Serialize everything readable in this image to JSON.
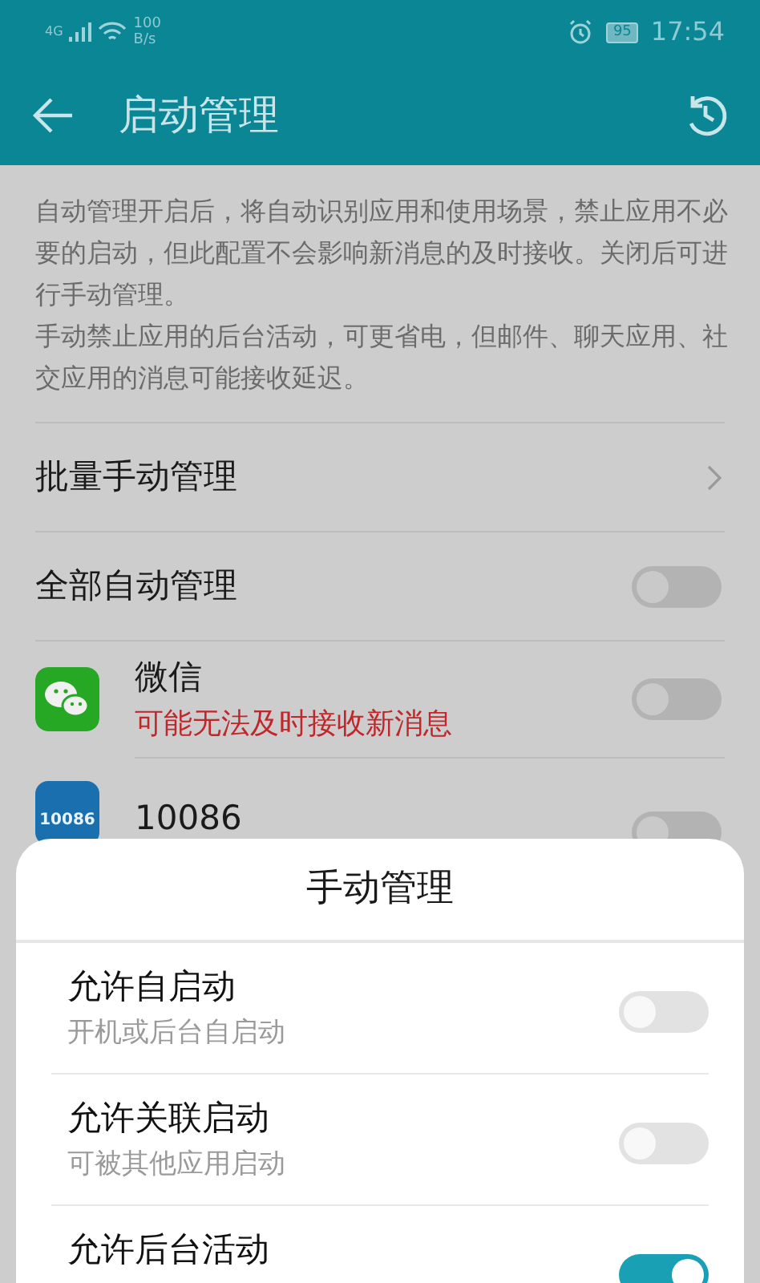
{
  "status_bar": {
    "network": "4G",
    "speed_value": "100",
    "speed_unit": "B/s",
    "battery": "95",
    "time": "17:54"
  },
  "toolbar": {
    "title": "启动管理"
  },
  "description": [
    "自动管理开启后，将自动识别应用和使用场景，禁止应用不必要的启动，但此配置不会影响新消息的及时接收。关闭后可进行手动管理。",
    "手动禁止应用的后台活动，可更省电，但邮件、聊天应用、社交应用的消息可能接收延迟。"
  ],
  "batch": {
    "label": "批量手动管理"
  },
  "all_auto": {
    "label": "全部自动管理",
    "on": false
  },
  "apps": [
    {
      "kind": "chat",
      "name": "微信",
      "note": "可能无法及时接收新消息",
      "warning": true,
      "on": false
    },
    {
      "kind": "carrier",
      "name": "10086",
      "icon_text": "10086",
      "on": false
    }
  ],
  "sheet": {
    "title": "手动管理",
    "options": [
      {
        "label": "允许自启动",
        "sub": "开机或后台自启动",
        "on": false
      },
      {
        "label": "允许关联启动",
        "sub": "可被其他应用启动",
        "on": false
      },
      {
        "label": "允许后台活动",
        "on": true
      }
    ]
  }
}
